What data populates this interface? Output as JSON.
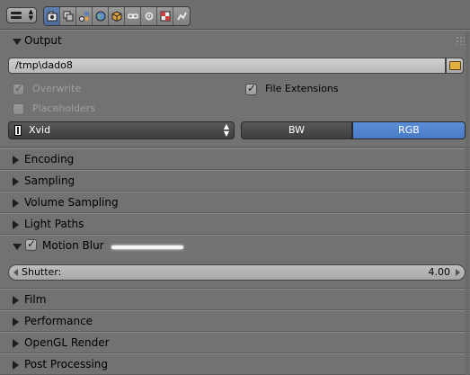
{
  "header": {
    "tabs": [
      {
        "icon": "render-camera-icon",
        "active": true
      },
      {
        "icon": "render-layers-icon",
        "active": false
      },
      {
        "icon": "scene-icon",
        "active": false
      },
      {
        "icon": "world-icon",
        "active": false
      },
      {
        "icon": "object-icon",
        "active": false
      },
      {
        "icon": "constraints-icon",
        "active": false
      },
      {
        "icon": "modifiers-icon",
        "active": false
      },
      {
        "icon": "texture-icon",
        "active": false
      },
      {
        "icon": "physics-icon",
        "active": false
      }
    ]
  },
  "output": {
    "title": "Output",
    "path": "/tmp\\dado8",
    "overwrite_label": "Overwrite",
    "overwrite_checked": true,
    "file_extensions_label": "File Extensions",
    "file_extensions_checked": true,
    "placeholders_label": "Placeholders",
    "placeholders_checked": false,
    "codec": "Xvid",
    "color_modes": [
      "BW",
      "RGB"
    ],
    "color_mode_selected": "RGB"
  },
  "panels": {
    "encoding": "Encoding",
    "sampling": "Sampling",
    "volume_sampling": "Volume Sampling",
    "light_paths": "Light Paths",
    "motion_blur": "Motion Blur",
    "film": "Film",
    "performance": "Performance",
    "opengl_render": "OpenGL Render",
    "post_processing": "Post Processing"
  },
  "motion_blur": {
    "enabled": true,
    "shutter_label": "Shutter:",
    "shutter_value": "4.00"
  },
  "colors": {
    "background": "#727272",
    "accent_selected": "#5b8ed8",
    "dark_button": "#4a4a4a"
  }
}
